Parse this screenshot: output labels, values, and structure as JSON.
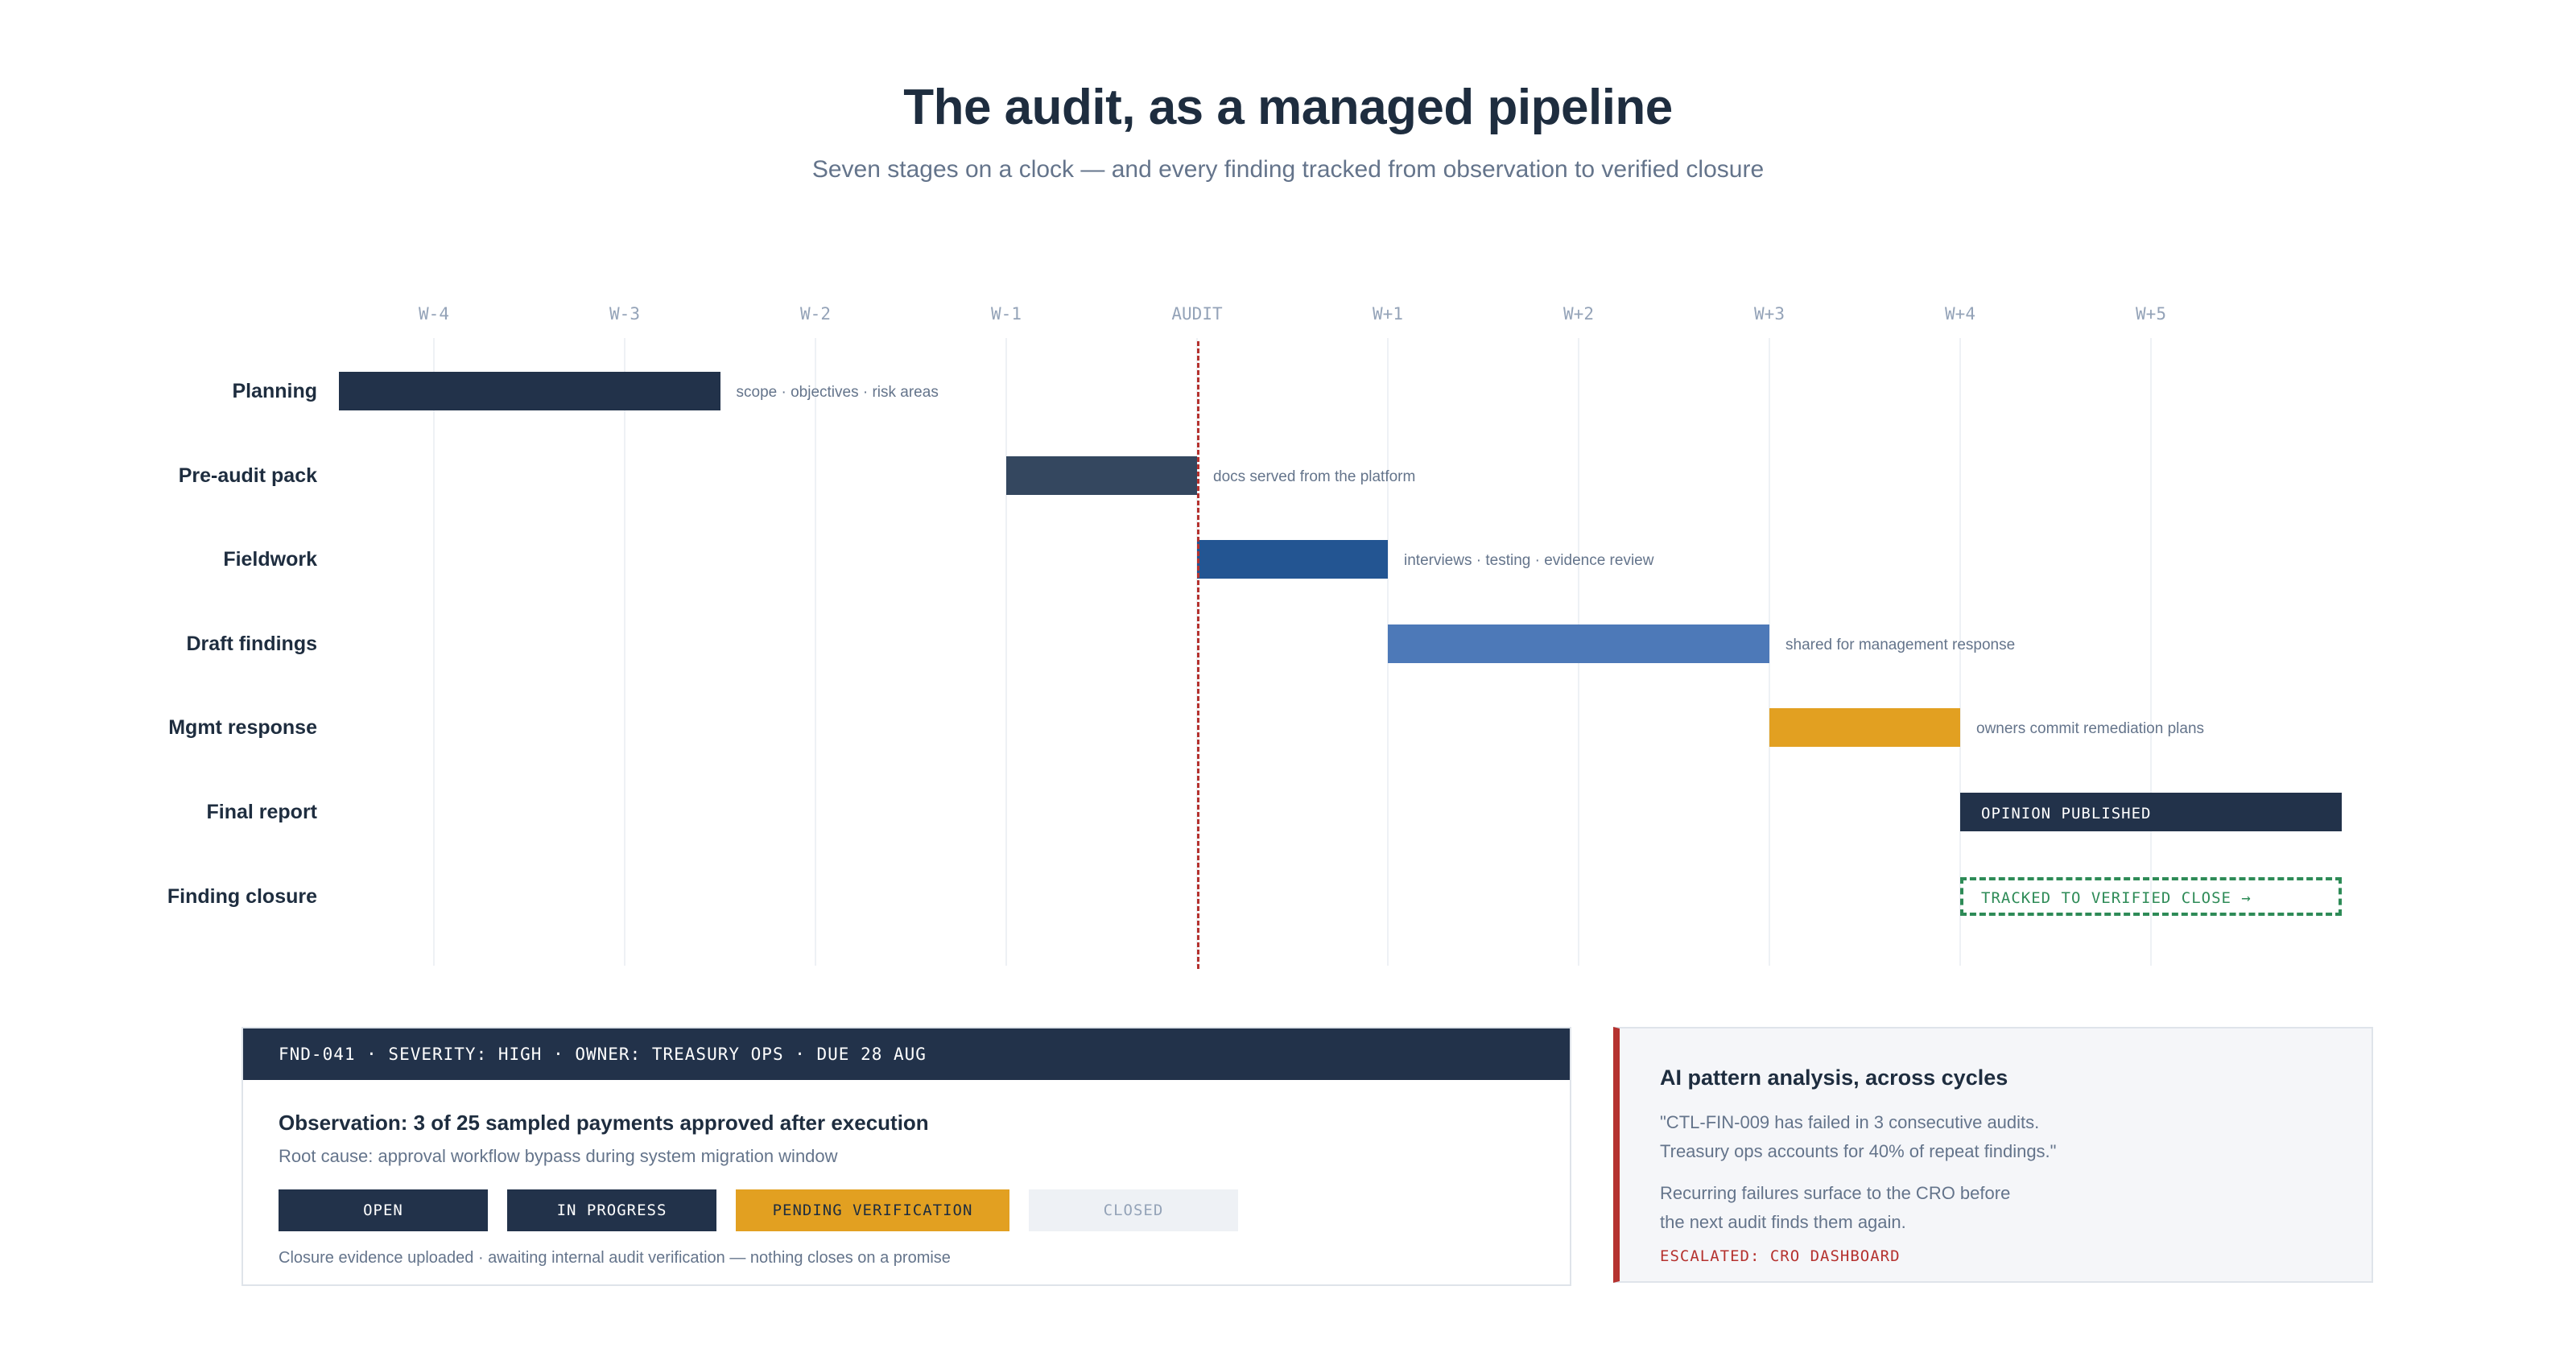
{
  "title": "The audit, as a managed pipeline",
  "subtitle": "Seven stages on a clock — and every finding tracked from observation to verified closure",
  "timeline": {
    "ticks": [
      "W-4",
      "W-3",
      "W-2",
      "W-1",
      "AUDIT",
      "W+1",
      "W+2",
      "W+3",
      "W+4",
      "W+5"
    ],
    "audit_marker": "AUDIT",
    "stages": [
      {
        "label": "Planning",
        "start": -4.5,
        "end": -2.5,
        "color": "#22324a",
        "note": "scope · objectives · risk areas"
      },
      {
        "label": "Pre-audit pack",
        "start": -1,
        "end": 0,
        "color": "#34475f",
        "note": "docs served from the platform"
      },
      {
        "label": "Fieldwork",
        "start": 0,
        "end": 1,
        "color": "#235592",
        "note": "interviews · testing · evidence review"
      },
      {
        "label": "Draft findings",
        "start": 1,
        "end": 3,
        "color": "#4d79b8",
        "note": "shared for management response"
      },
      {
        "label": "Mgmt response",
        "start": 3,
        "end": 4,
        "color": "#e2a021",
        "note": "owners commit remediation plans"
      },
      {
        "label": "Final report",
        "start": 4,
        "end": 6,
        "color": "#22324a",
        "inside_text": "OPINION PUBLISHED"
      },
      {
        "label": "Finding closure",
        "start": 4,
        "end": 6,
        "style": "dashed",
        "color": "#2e8b57",
        "inside_text": "TRACKED TO VERIFIED CLOSE →"
      }
    ]
  },
  "finding": {
    "header": "FND-041 · SEVERITY: HIGH · OWNER: TREASURY OPS · DUE 28 AUG",
    "observation": "Observation: 3 of 25 sampled payments approved after execution",
    "root_cause": "Root cause: approval workflow bypass during system migration window",
    "statuses": [
      {
        "label": "OPEN",
        "state": "done"
      },
      {
        "label": "IN PROGRESS",
        "state": "done"
      },
      {
        "label": "PENDING VERIFICATION",
        "state": "current"
      },
      {
        "label": "CLOSED",
        "state": "todo"
      }
    ],
    "closure_note": "Closure evidence uploaded · awaiting internal audit verification — nothing closes on a promise"
  },
  "ai": {
    "title": "AI pattern analysis, across cycles",
    "quote_line1": "\"CTL-FIN-009 has failed in 3 consecutive audits.",
    "quote_line2": "Treasury ops accounts for 40% of repeat findings.\"",
    "body_line1": "Recurring failures surface to the CRO before",
    "body_line2": "the next audit finds them again.",
    "escalated": "ESCALATED: CRO DASHBOARD"
  },
  "colors": {
    "navy": "#22324a",
    "accent_red": "#b5322f",
    "amber": "#e2a021",
    "green": "#2e8b57"
  }
}
